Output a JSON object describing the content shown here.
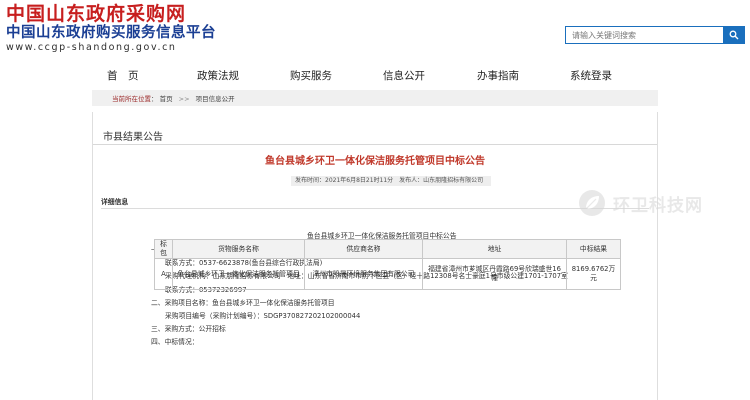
{
  "header": {
    "logo_line1": "中国山东政府采购网",
    "logo_line2": "中国山东政府购买服务信息平台",
    "logo_line3": "www.ccgp-shandong.gov.cn",
    "search_placeholder": "请输入关键词搜索"
  },
  "nav": {
    "items": [
      "首　页",
      "政策法规",
      "购买服务",
      "信息公开",
      "办事指南",
      "系统登录"
    ]
  },
  "breadcrumb": {
    "current_label": "当前所在位置",
    "home": "首页",
    "separator": ">>",
    "section": "项目信息公开"
  },
  "panel": {
    "title": "市县结果公告",
    "doc_title": "鱼台县城乡环卫一体化保洁服务托管项目中标公告",
    "meta": "发布时间：2021年6月8日21时11分　发布人：山东朋隆招标有限公司",
    "detail_label": "详细信息"
  },
  "body": {
    "line0": "鱼台县城乡环卫一体化保洁服务托管项目中标公告",
    "line1": "一、采购人：鱼台县综合行政执法局　地址：湖凌三路南首(鱼台县综合行政执法局)",
    "line2": "联系方式：0537-6623878(鱼台县综合行政执法局)",
    "line3": "采购代理机构：山东朋隆招标有限公司　地址：山东省省济南市市历下区县（区）经十路12308号名士豪庭1号市级公建1701-1707室",
    "line4": "联系方式：05372326997",
    "line5": "二、采购项目名称：鱼台县城乡环卫一体化保洁服务托管项目",
    "line6": "采购项目编号（采购计划编号）：SDGP370827202102000044",
    "line7": "三、采购方式：公开招标",
    "line8": "四、中标情况："
  },
  "table": {
    "headers": {
      "lot": "标包",
      "name": "货物服务名称",
      "supplier": "供应商名称",
      "address": "地址",
      "price": "中标结果"
    },
    "rows": [
      {
        "lot": "A",
        "name": "鱼台县城乡环卫一体化保洁服务托管项目",
        "supplier": "漳州市凯晟环境服务集团有限公司",
        "address": "福建省漳州市芗城区丹霞路69号欣瑞盛世16幢",
        "price": "8169.6762万元"
      }
    ]
  },
  "watermark": {
    "text": "环卫科技网"
  },
  "colors": {
    "logo_red": "#c71f1f",
    "logo_blue": "#1b3f94",
    "search_blue": "#1a6fbd",
    "doc_title_red": "#c0392b"
  },
  "icons": {
    "search_button": "search-icon",
    "watermark_logo": "leaf-logo-icon"
  }
}
